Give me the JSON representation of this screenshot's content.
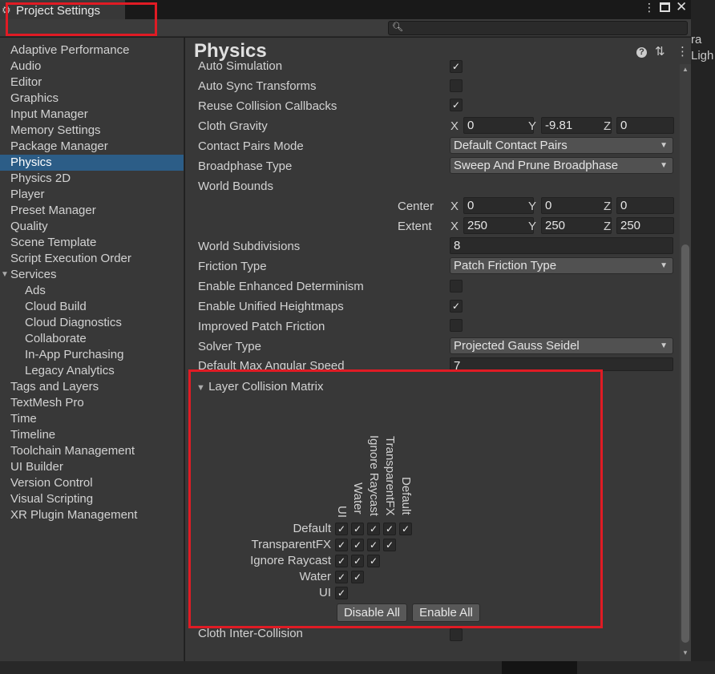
{
  "window": {
    "tab_title": "Project Settings",
    "menu_icon": "kebab-menu-icon",
    "maximize_icon": "maximize-icon",
    "close_icon": "close-icon",
    "right_panel_text": [
      "ra",
      "Ligh"
    ]
  },
  "search": {
    "placeholder": "",
    "value": ""
  },
  "sidebar": {
    "items": [
      {
        "label": "Adaptive Performance",
        "sub": false
      },
      {
        "label": "Audio",
        "sub": false
      },
      {
        "label": "Editor",
        "sub": false
      },
      {
        "label": "Graphics",
        "sub": false
      },
      {
        "label": "Input Manager",
        "sub": false
      },
      {
        "label": "Memory Settings",
        "sub": false
      },
      {
        "label": "Package Manager",
        "sub": false
      },
      {
        "label": "Physics",
        "sub": false,
        "selected": true
      },
      {
        "label": "Physics 2D",
        "sub": false
      },
      {
        "label": "Player",
        "sub": false
      },
      {
        "label": "Preset Manager",
        "sub": false
      },
      {
        "label": "Quality",
        "sub": false
      },
      {
        "label": "Scene Template",
        "sub": false
      },
      {
        "label": "Script Execution Order",
        "sub": false
      },
      {
        "label": "Services",
        "sub": false,
        "foldout": true
      },
      {
        "label": "Ads",
        "sub": true
      },
      {
        "label": "Cloud Build",
        "sub": true
      },
      {
        "label": "Cloud Diagnostics",
        "sub": true
      },
      {
        "label": "Collaborate",
        "sub": true
      },
      {
        "label": "In-App Purchasing",
        "sub": true
      },
      {
        "label": "Legacy Analytics",
        "sub": true
      },
      {
        "label": "Tags and Layers",
        "sub": false
      },
      {
        "label": "TextMesh Pro",
        "sub": false
      },
      {
        "label": "Time",
        "sub": false
      },
      {
        "label": "Timeline",
        "sub": false
      },
      {
        "label": "Toolchain Management",
        "sub": false
      },
      {
        "label": "UI Builder",
        "sub": false
      },
      {
        "label": "Version Control",
        "sub": false
      },
      {
        "label": "Visual Scripting",
        "sub": false
      },
      {
        "label": "XR Plugin Management",
        "sub": false
      }
    ]
  },
  "main": {
    "title": "Physics",
    "props": {
      "auto_simulation": {
        "label": "Auto Simulation",
        "checked": true
      },
      "auto_sync": {
        "label": "Auto Sync Transforms",
        "checked": false
      },
      "reuse_callbacks": {
        "label": "Reuse Collision Callbacks",
        "checked": true
      },
      "cloth_gravity": {
        "label": "Cloth Gravity",
        "x": "0",
        "y": "-9.81",
        "z": "0"
      },
      "contact_pairs": {
        "label": "Contact Pairs Mode",
        "value": "Default Contact Pairs"
      },
      "broadphase": {
        "label": "Broadphase Type",
        "value": "Sweep And Prune Broadphase"
      },
      "world_bounds": {
        "label": "World Bounds"
      },
      "center": {
        "label": "Center",
        "x": "0",
        "y": "0",
        "z": "0"
      },
      "extent": {
        "label": "Extent",
        "x": "250",
        "y": "250",
        "z": "250"
      },
      "world_subdivisions": {
        "label": "World Subdivisions",
        "value": "8"
      },
      "friction_type": {
        "label": "Friction Type",
        "value": "Patch Friction Type"
      },
      "enhanced_determinism": {
        "label": "Enable Enhanced Determinism",
        "checked": false
      },
      "unified_heightmaps": {
        "label": "Enable Unified Heightmaps",
        "checked": true
      },
      "improved_patch": {
        "label": "Improved Patch Friction",
        "checked": false
      },
      "solver_type": {
        "label": "Solver Type",
        "value": "Projected Gauss Seidel"
      },
      "max_angular": {
        "label": "Default Max Angular Speed",
        "value": "7"
      },
      "cloth_inter": {
        "label": "Cloth Inter-Collision",
        "checked": false
      }
    },
    "axis": {
      "x": "X",
      "y": "Y",
      "z": "Z"
    },
    "matrix": {
      "title": "Layer Collision Matrix",
      "layers": [
        "Default",
        "TransparentFX",
        "Ignore Raycast",
        "Water",
        "UI"
      ],
      "disable_all": "Disable All",
      "enable_all": "Enable All",
      "check": "✓"
    }
  }
}
